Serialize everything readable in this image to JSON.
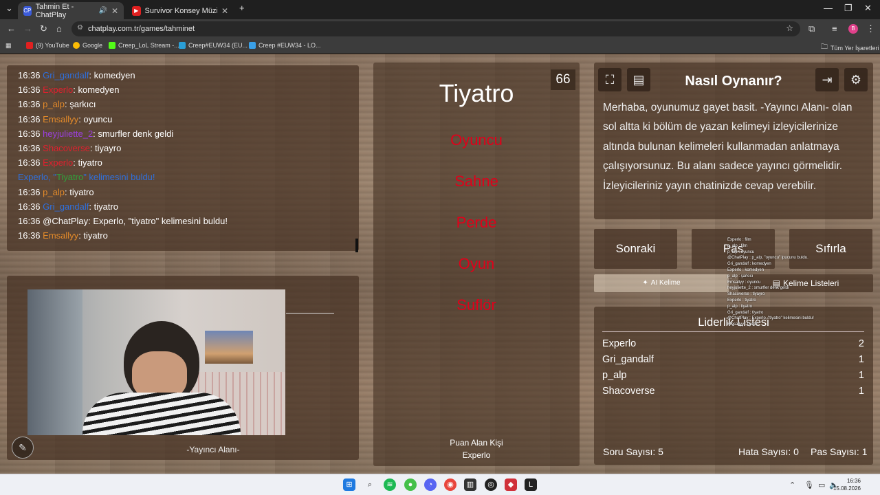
{
  "browser": {
    "tabs": [
      {
        "title": "Tahmin Et - ChatPlay"
      },
      {
        "title": "Survivor Konsey Müziği (Uzun V"
      }
    ],
    "url": "chatplay.com.tr/games/tahminet",
    "bookmarks": [
      {
        "label": "(9) YouTube"
      },
      {
        "label": "Google"
      },
      {
        "label": "Creep_LoL Stream -..."
      },
      {
        "label": "Creep#EUW34 (EU..."
      },
      {
        "label": "Creep #EUW34 - LO..."
      }
    ],
    "all_bookmarks": "Tüm Yer İşaretleri",
    "profile_initial": "B"
  },
  "chat": {
    "messages": [
      {
        "time": "16:36",
        "user": "Gri_gandalf",
        "user_color": "#2f6fdc",
        "text": ": komedyen"
      },
      {
        "time": "16:36",
        "user": "Experlo",
        "user_color": "#e0202e",
        "text": ": komedyen"
      },
      {
        "time": "16:36",
        "user": "p_alp",
        "user_color": "#e38a2a",
        "text": ": şarkıcı"
      },
      {
        "time": "16:36",
        "user": "Emsallyy",
        "user_color": "#e38a2a",
        "text": ": oyuncu"
      },
      {
        "time": "16:36",
        "user": "heyjuliette_2",
        "user_color": "#9b3fe0",
        "text": ": smurfler denk geldi"
      },
      {
        "time": "16:36",
        "user": "Shacoverse",
        "user_color": "#e0202e",
        "text": ": tiyayro"
      },
      {
        "time": "16:36",
        "user": "Experlo",
        "user_color": "#e0202e",
        "text": ": tiyatro"
      },
      {
        "time": "",
        "user": "",
        "user_color": "#ffffff",
        "text": ""
      },
      {
        "time": "16:36",
        "user": "p_alp",
        "user_color": "#e38a2a",
        "text": ": tiyatro"
      },
      {
        "time": "16:36",
        "user": "Gri_gandalf",
        "user_color": "#2f6fdc",
        "text": ": tiyatro"
      },
      {
        "time": "16:36",
        "user": "",
        "user_color": "#ffffff",
        "text": "@ChatPlay: Experlo, \"tiyatro\" kelimesini buldu!"
      },
      {
        "time": "16:36",
        "user": "Emsallyy",
        "user_color": "#e38a2a",
        "text": ": tiyatro"
      }
    ],
    "system": {
      "user": "Experlo, ",
      "quote_open": "\"",
      "word": "Tiyatro",
      "quote_close": "\"",
      "rest": " kelimesini buldu!"
    }
  },
  "streamer": {
    "label": "-Yayıncı Alanı-"
  },
  "word_card": {
    "counter": "66",
    "word": "Tiyatro",
    "forbidden": [
      "Oyuncu",
      "Sahne",
      "Perde",
      "Oyun",
      "Suflör"
    ],
    "scorer_label": "Puan Alan Kişi",
    "scorer_name": "Experlo"
  },
  "howto": {
    "title": "Nasıl Oynanır?",
    "text": "Merhaba, oyunumuz gayet basit. -Yayıncı Alanı- olan sol altta ki bölüm de yazan kelimeyi izleyicilerinize altında bulunan kelimeleri kullanmadan anlatmaya çalışıyorsunuz. Bu alanı sadece yayıncı görmelidir. İzleyicileriniz yayın chatinizde cevap verebilir."
  },
  "controls": {
    "next": "Sonraki",
    "pass": "Pas",
    "reset": "Sıfırla",
    "ai_word": "AI Kelime",
    "word_lists": "Kelime Listeleri"
  },
  "leaderboard": {
    "title": "Liderlik Listesi",
    "rows": [
      {
        "name": "Experlo",
        "score": "2"
      },
      {
        "name": "Gri_gandalf",
        "score": "1"
      },
      {
        "name": "p_alp",
        "score": "1"
      },
      {
        "name": "Shacoverse",
        "score": "1"
      }
    ]
  },
  "stats": {
    "questions": "Soru Sayısı: 5",
    "errors": "Hata Sayısı: 0",
    "passes": "Pas Sayısı: 1"
  },
  "overlay_chat": [
    "Experlo : film",
    "p_alp : film",
    "p_alp : oyuncu",
    "@ChatPlay : p_alp, \"oyuncu\" ipucunu buldu.",
    "Gri_gandalf : komedyen",
    "Experlo : komedyen",
    "p_alp : şarkıcı",
    "Emsallyy : oyuncu",
    "heyjuliette_2 : smurfler denk geldi",
    "Shacoverse : tiyayro",
    "Experlo : tiyatro",
    "p_alp : tiyatro",
    "Gri_gandalf : tiyatro",
    "@ChatPlay : Experlo, \"tiyatro\" kelimesini buldu!",
    "Emsallyy : tiyatro"
  ],
  "taskbar": {
    "time": "16:36",
    "date": "15.08.2026"
  }
}
